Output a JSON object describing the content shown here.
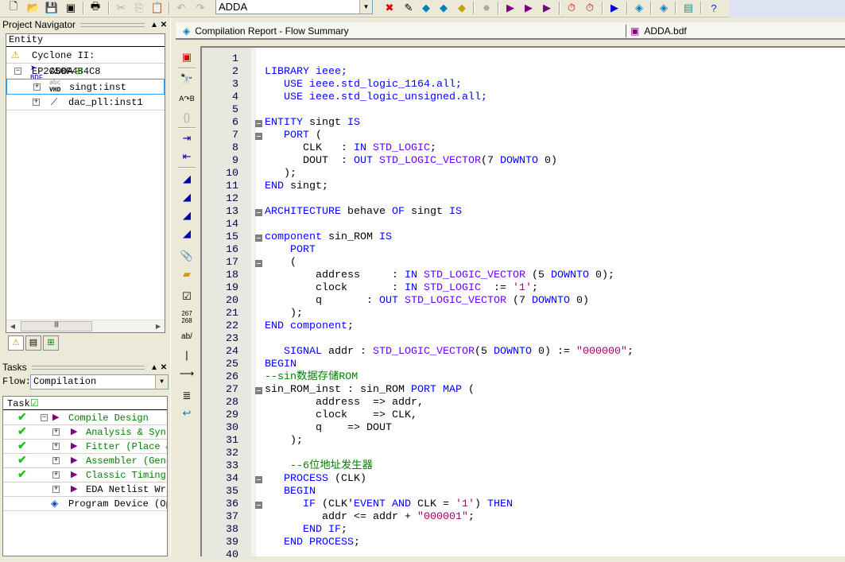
{
  "toolbar": {
    "entity_combo": "ADDA"
  },
  "project_navigator": {
    "title": "Project Navigator",
    "column": "Entity",
    "device": "Cyclone II: EP2C50F484C8",
    "items": [
      {
        "label": "ADDA",
        "badge": "BDF"
      },
      {
        "label": "singt:inst",
        "badge": "VHD"
      },
      {
        "label": "dac_pll:inst1"
      }
    ]
  },
  "tasks": {
    "title": "Tasks",
    "flow_label": "Flow:",
    "flow_value": "Compilation",
    "column": "Task",
    "items": [
      {
        "label": "Compile Design",
        "done": true
      },
      {
        "label": "Analysis & Synthe",
        "done": true
      },
      {
        "label": "Fitter (Place & R",
        "done": true
      },
      {
        "label": "Assembler (Genera",
        "done": true
      },
      {
        "label": "Classic Timing An",
        "done": true
      },
      {
        "label": "EDA Netlist Write",
        "done": false
      },
      {
        "label": "Program Device (Open",
        "done": false
      }
    ]
  },
  "tabs": [
    {
      "label": "Compilation Report - Flow Summary"
    },
    {
      "label": "ADDA.bdf"
    }
  ],
  "colors": {
    "keyword": "#0000ff",
    "type": "#6a00ff",
    "string": "#a0006a",
    "comment": "#008000",
    "done_check": "#22c022"
  },
  "code": {
    "fold_lines": [
      6,
      7,
      13,
      15,
      17,
      27,
      34,
      36
    ],
    "lines": [
      [],
      [
        [
          "LIBRARY ieee;",
          "k"
        ]
      ],
      [
        [
          "   USE ieee.std_logic_1164.all;",
          "k"
        ]
      ],
      [
        [
          "   USE ieee.std_logic_unsigned.all;",
          "k"
        ]
      ],
      [],
      [
        [
          "ENTITY",
          "k"
        ],
        [
          " singt ",
          ""
        ],
        [
          "IS",
          "k"
        ]
      ],
      [
        [
          "   PORT",
          "k"
        ],
        [
          " (",
          ""
        ]
      ],
      [
        [
          "      CLK   : ",
          ""
        ],
        [
          "IN",
          "k"
        ],
        [
          " ",
          ""
        ],
        [
          "STD_LOGIC",
          "t"
        ],
        [
          ";",
          ""
        ]
      ],
      [
        [
          "      DOUT  : ",
          ""
        ],
        [
          "OUT",
          "k"
        ],
        [
          " ",
          ""
        ],
        [
          "STD_LOGIC_VECTOR",
          "t"
        ],
        [
          "(7 ",
          ""
        ],
        [
          "DOWNTO",
          "k"
        ],
        [
          " 0)",
          ""
        ]
      ],
      [
        [
          "   );",
          ""
        ]
      ],
      [
        [
          "END",
          "k"
        ],
        [
          " singt;",
          ""
        ]
      ],
      [],
      [
        [
          "ARCHITECTURE",
          "k"
        ],
        [
          " behave ",
          ""
        ],
        [
          "OF",
          "k"
        ],
        [
          " singt ",
          ""
        ],
        [
          "IS",
          "k"
        ]
      ],
      [],
      [
        [
          "component",
          "k"
        ],
        [
          " sin_ROM ",
          ""
        ],
        [
          "IS",
          "k"
        ]
      ],
      [
        [
          "    PORT",
          "k"
        ]
      ],
      [
        [
          "    (",
          ""
        ]
      ],
      [
        [
          "        address     : ",
          ""
        ],
        [
          "IN",
          "k"
        ],
        [
          " ",
          ""
        ],
        [
          "STD_LOGIC_VECTOR",
          "t"
        ],
        [
          " (5 ",
          ""
        ],
        [
          "DOWNTO",
          "k"
        ],
        [
          " 0);",
          ""
        ]
      ],
      [
        [
          "        clock       : ",
          ""
        ],
        [
          "IN",
          "k"
        ],
        [
          " ",
          ""
        ],
        [
          "STD_LOGIC",
          "t"
        ],
        [
          "  := ",
          ""
        ],
        [
          "'1'",
          "s"
        ],
        [
          ";",
          ""
        ]
      ],
      [
        [
          "        q       : ",
          ""
        ],
        [
          "OUT",
          "k"
        ],
        [
          " ",
          ""
        ],
        [
          "STD_LOGIC_VECTOR",
          "t"
        ],
        [
          " (7 ",
          ""
        ],
        [
          "DOWNTO",
          "k"
        ],
        [
          " 0)",
          ""
        ]
      ],
      [
        [
          "    );",
          ""
        ]
      ],
      [
        [
          "END",
          "k"
        ],
        [
          " ",
          ""
        ],
        [
          "component",
          "k"
        ],
        [
          ";",
          ""
        ]
      ],
      [],
      [
        [
          "   SIGNAL",
          "k"
        ],
        [
          " addr : ",
          ""
        ],
        [
          "STD_LOGIC_VECTOR",
          "t"
        ],
        [
          "(5 ",
          ""
        ],
        [
          "DOWNTO",
          "k"
        ],
        [
          " 0) := ",
          ""
        ],
        [
          "\"000000\"",
          "s"
        ],
        [
          ";",
          ""
        ]
      ],
      [
        [
          "BEGIN",
          "k"
        ]
      ],
      [
        [
          "--sin数据存储ROM",
          "c"
        ]
      ],
      [
        [
          "sin_ROM_inst : sin_ROM ",
          ""
        ],
        [
          "PORT",
          "k"
        ],
        [
          " ",
          ""
        ],
        [
          "MAP",
          "k"
        ],
        [
          " (",
          ""
        ]
      ],
      [
        [
          "        address  => addr,",
          ""
        ]
      ],
      [
        [
          "        clock    => CLK,",
          ""
        ]
      ],
      [
        [
          "        q    => DOUT",
          ""
        ]
      ],
      [
        [
          "    );",
          ""
        ]
      ],
      [],
      [
        [
          "    --6位地址发生器",
          "c"
        ]
      ],
      [
        [
          "   PROCESS",
          "k"
        ],
        [
          " (CLK)",
          ""
        ]
      ],
      [
        [
          "   BEGIN",
          "k"
        ]
      ],
      [
        [
          "      IF",
          "k"
        ],
        [
          " (CLK'",
          ""
        ],
        [
          "EVENT",
          "k"
        ],
        [
          " ",
          ""
        ],
        [
          "AND",
          "k"
        ],
        [
          " CLK = ",
          ""
        ],
        [
          "'1'",
          "s"
        ],
        [
          ") ",
          ""
        ],
        [
          "THEN",
          "k"
        ]
      ],
      [
        [
          "         addr <= addr + ",
          ""
        ],
        [
          "\"000001\"",
          "s"
        ],
        [
          ";",
          ""
        ]
      ],
      [
        [
          "      END IF",
          "k"
        ],
        [
          ";",
          ""
        ]
      ],
      [
        [
          "   END PROCESS",
          "k"
        ],
        [
          ";",
          ""
        ]
      ],
      []
    ]
  }
}
